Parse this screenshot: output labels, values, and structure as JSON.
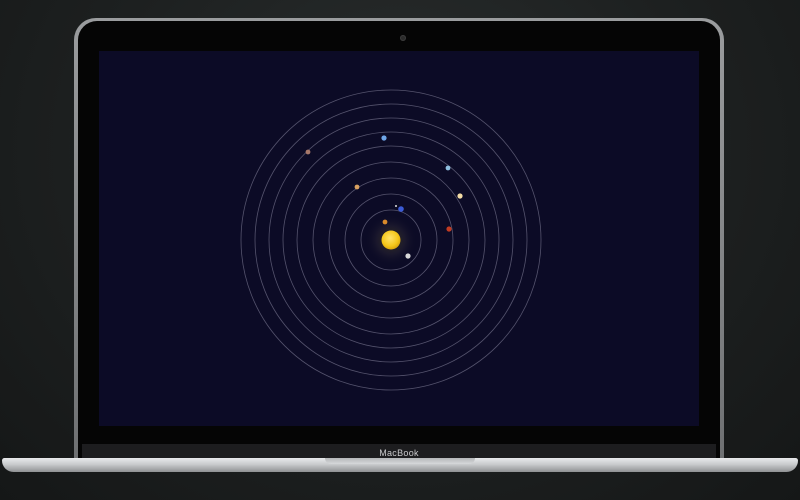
{
  "device": {
    "brand_label": "MacBook"
  },
  "colors": {
    "background": "#1d2020",
    "screen": "#0c0b26",
    "orbit": "#6d6c86",
    "sun": "#f5c71a"
  },
  "solar_system": {
    "sun": {
      "name": "sun"
    },
    "orbits": [
      {
        "name": "orbit-1"
      },
      {
        "name": "orbit-2"
      },
      {
        "name": "orbit-3"
      },
      {
        "name": "orbit-4"
      },
      {
        "name": "orbit-5"
      },
      {
        "name": "orbit-6"
      },
      {
        "name": "orbit-7"
      },
      {
        "name": "orbit-8"
      },
      {
        "name": "orbit-9"
      }
    ],
    "planets": [
      {
        "name": "planet-1",
        "color": "#d9d9d9"
      },
      {
        "name": "planet-2",
        "color": "#d98a2b"
      },
      {
        "name": "planet-3",
        "color": "#3b5bd6"
      },
      {
        "name": "planet-4",
        "color": "#c23b22"
      },
      {
        "name": "planet-5",
        "color": "#d8a060"
      },
      {
        "name": "planet-6",
        "color": "#f3dca6"
      },
      {
        "name": "planet-7",
        "color": "#8fbfe0"
      },
      {
        "name": "planet-8",
        "color": "#6fa6e8"
      },
      {
        "name": "planet-9",
        "color": "#a7786a"
      }
    ]
  }
}
